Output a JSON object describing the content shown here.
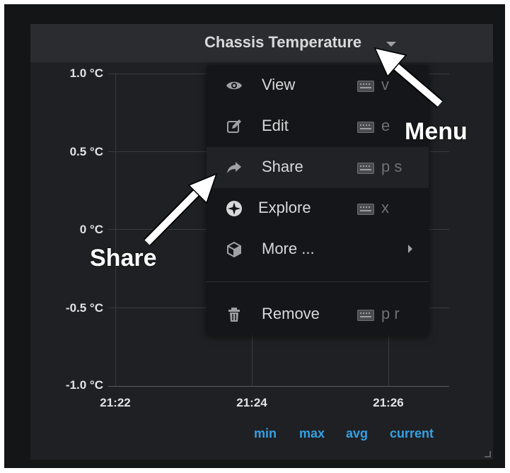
{
  "panel": {
    "title": "Chassis Temperature",
    "caret_icon": "caret-down-icon"
  },
  "graph": {
    "y_labels": [
      "1.0 °C",
      "0.5 °C",
      "0 °C",
      "-0.5 °C",
      "-1.0 °C"
    ],
    "x_labels": [
      "21:22",
      "21:24",
      "21:26"
    ],
    "legend": [
      "min",
      "max",
      "avg",
      "current"
    ],
    "legend_color": "#33a2e5"
  },
  "menu": {
    "items": [
      {
        "icon": "eye-icon",
        "label": "View",
        "shortcut": "v",
        "kb_icon": "keyboard-icon"
      },
      {
        "icon": "edit-icon",
        "label": "Edit",
        "shortcut": "e",
        "kb_icon": "keyboard-icon"
      },
      {
        "icon": "share-icon",
        "label": "Share",
        "shortcut": "p s",
        "kb_icon": "keyboard-icon",
        "highlighted": true
      },
      {
        "icon": "compass-icon",
        "label": "Explore",
        "shortcut": "x",
        "kb_icon": "keyboard-icon"
      },
      {
        "icon": "cube-icon",
        "label": "More ...",
        "submenu_icon": "chevron-right-icon"
      },
      {
        "icon": "trash-icon",
        "label": "Remove",
        "shortcut": "p r",
        "kb_icon": "keyboard-icon"
      }
    ]
  },
  "annotations": {
    "menu_label": "Menu",
    "share_label": "Share"
  }
}
